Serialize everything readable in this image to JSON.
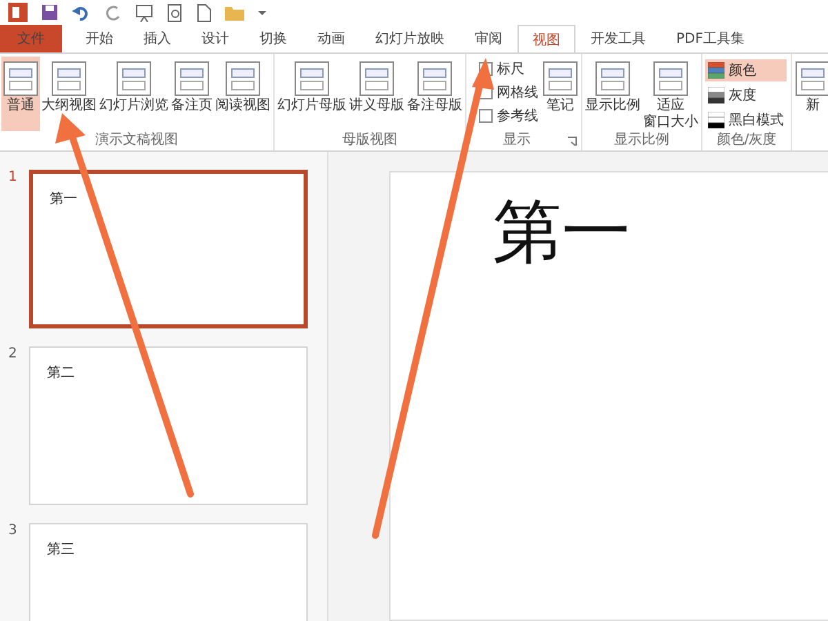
{
  "tabs": [
    {
      "label": "文件",
      "kind": "file",
      "selected": false
    },
    {
      "label": "开始",
      "kind": "tab",
      "selected": false
    },
    {
      "label": "插入",
      "kind": "tab",
      "selected": false
    },
    {
      "label": "设计",
      "kind": "tab",
      "selected": false
    },
    {
      "label": "切换",
      "kind": "tab",
      "selected": false
    },
    {
      "label": "动画",
      "kind": "tab",
      "selected": false
    },
    {
      "label": "幻灯片放映",
      "kind": "tab",
      "selected": false
    },
    {
      "label": "审阅",
      "kind": "tab",
      "selected": false
    },
    {
      "label": "视图",
      "kind": "tab",
      "selected": true
    },
    {
      "label": "开发工具",
      "kind": "tab",
      "selected": false
    },
    {
      "label": "PDF工具集",
      "kind": "tab",
      "selected": false
    }
  ],
  "ribbon": {
    "groups": [
      {
        "label": "演示文稿视图",
        "items": [
          {
            "kind": "large",
            "label_lines": [
              "普通"
            ],
            "selected": true
          },
          {
            "kind": "large",
            "label_lines": [
              "大纲视图"
            ],
            "selected": false
          },
          {
            "kind": "large",
            "label_lines": [
              "幻灯片浏览"
            ],
            "selected": false
          },
          {
            "kind": "large",
            "label_lines": [
              "备注页"
            ],
            "selected": false
          },
          {
            "kind": "large",
            "label_lines": [
              "阅读视图"
            ],
            "selected": false
          }
        ]
      },
      {
        "label": "母版视图",
        "items": [
          {
            "kind": "large",
            "label_lines": [
              "幻灯片母版"
            ],
            "selected": false
          },
          {
            "kind": "large",
            "label_lines": [
              "讲义母版"
            ],
            "selected": false
          },
          {
            "kind": "large",
            "label_lines": [
              "备注母版"
            ],
            "selected": false
          }
        ]
      },
      {
        "label": "显示",
        "launcher": true,
        "items": [
          {
            "kind": "checks",
            "checks": [
              {
                "label": "标尺",
                "checked": false
              },
              {
                "label": "网格线",
                "checked": false
              },
              {
                "label": "参考线",
                "checked": false
              }
            ]
          },
          {
            "kind": "large",
            "label_lines": [
              "笔记"
            ],
            "selected": false
          }
        ]
      },
      {
        "label": "显示比例",
        "items": [
          {
            "kind": "large",
            "label_lines": [
              "显示比例"
            ],
            "selected": false
          },
          {
            "kind": "large",
            "label_lines": [
              "适应",
              "窗口大小"
            ],
            "selected": false
          }
        ]
      },
      {
        "label": "颜色/灰度",
        "items": [
          {
            "kind": "colors",
            "options": [
              {
                "label": "颜色",
                "selected": true
              },
              {
                "label": "灰度",
                "selected": false
              },
              {
                "label": "黑白模式",
                "selected": false
              }
            ]
          }
        ]
      },
      {
        "items": [
          {
            "kind": "large",
            "label_lines": [
              "新"
            ]
          }
        ]
      }
    ]
  },
  "slides": [
    {
      "number": "1",
      "title": "第一",
      "selected": true
    },
    {
      "number": "2",
      "title": "第二",
      "selected": false
    },
    {
      "number": "3",
      "title": "第三",
      "selected": false
    }
  ],
  "main_slide": {
    "title": "第一"
  }
}
